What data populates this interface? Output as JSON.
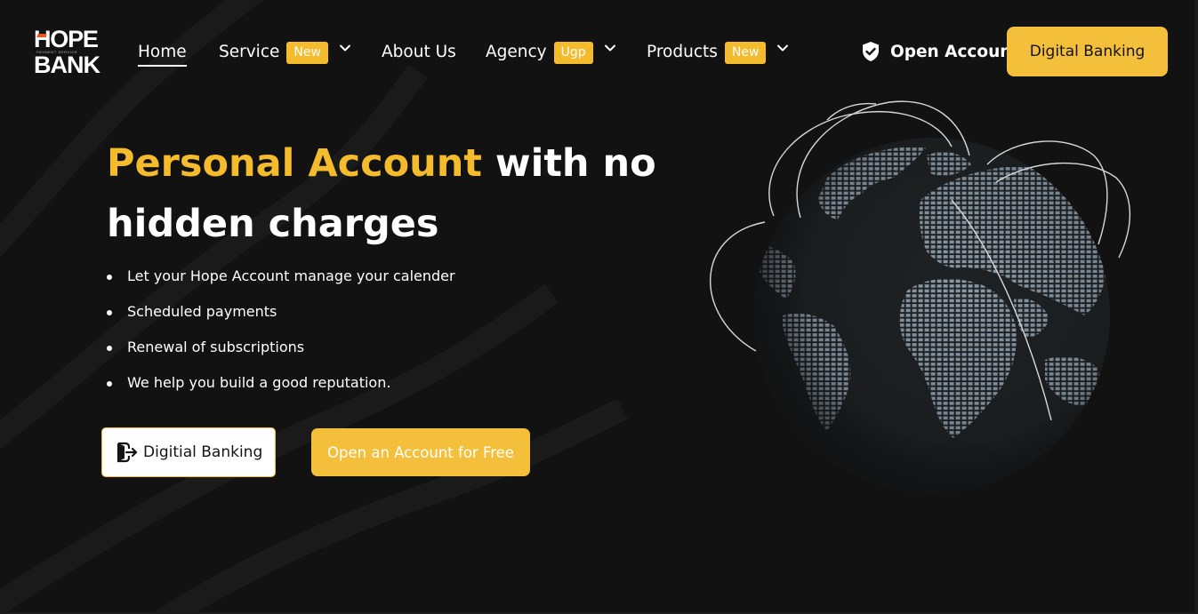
{
  "brand": {
    "logo_line1": "HOPE",
    "logo_tagline": "PAYMENT SERVICE",
    "logo_line2": "BANK",
    "accent_color": "#f4bb2c",
    "background_color": "#121212"
  },
  "nav": {
    "home": "Home",
    "service": "Service",
    "service_badge": "New",
    "about": "About Us",
    "agency": "Agency",
    "agency_badge": "Ugp",
    "products": "Products",
    "products_badge": "New"
  },
  "header": {
    "open_account": "Open Account",
    "open_account_icon": "shield-check-icon",
    "digital_banking": "Digital Banking"
  },
  "hero": {
    "title_accent": "Personal Account",
    "title_rest": " with no hidden charges",
    "bullets": [
      "Let your Hope Account manage your calender",
      "Scheduled payments",
      "Renewal of subscriptions",
      "We help you build a good reputation."
    ],
    "primary_button": "Digitial Banking",
    "primary_button_icon": "login-icon",
    "secondary_button": "Open an Account for Free",
    "illustration": "globe-illustration"
  }
}
